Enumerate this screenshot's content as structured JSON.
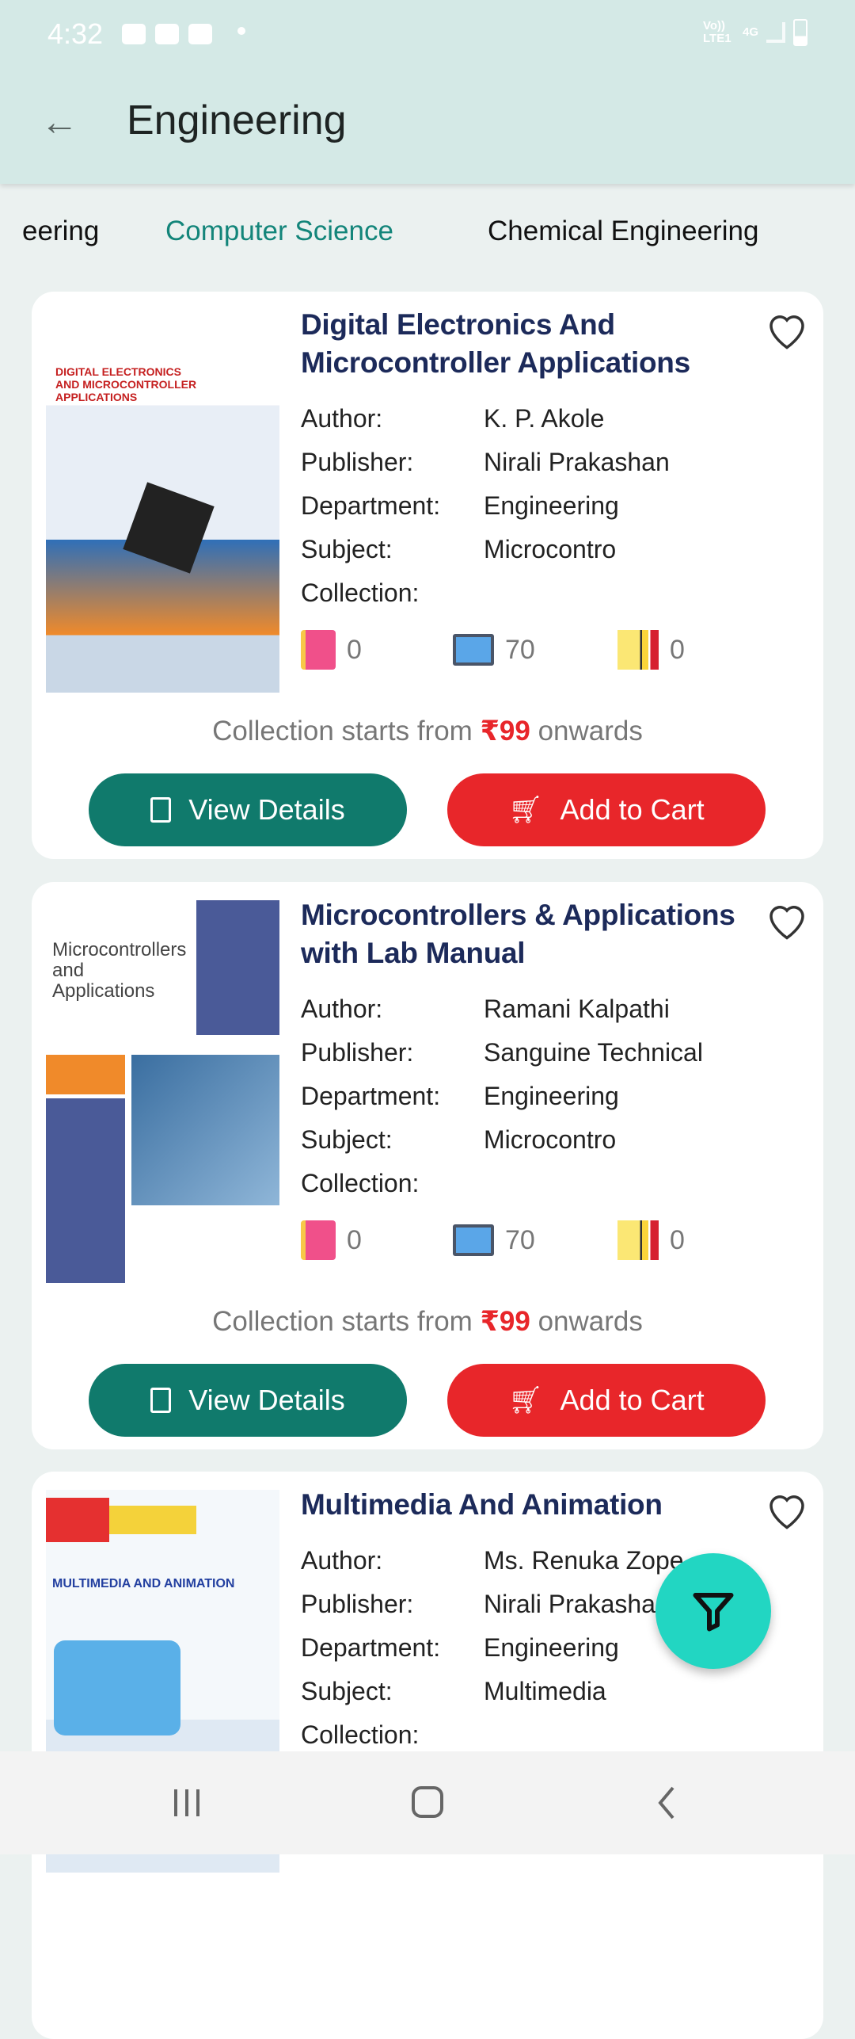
{
  "status_bar": {
    "time": "4:32",
    "network": "Vo)) LTE1",
    "net_type": "4G"
  },
  "header": {
    "title": "Engineering",
    "back_icon": "arrow-left-icon"
  },
  "tabs": [
    {
      "label": "eering",
      "active": false
    },
    {
      "label": "Computer Science",
      "active": true
    },
    {
      "label": "Chemical Engineering",
      "active": false
    }
  ],
  "labels": {
    "author": "Author:",
    "publisher": "Publisher:",
    "department": "Department:",
    "subject": "Subject:",
    "collection": "Collection:",
    "view_details": "View Details",
    "add_to_cart": "Add to Cart",
    "coll_prefix": "Collection starts from",
    "coll_suffix": "onwards"
  },
  "books": [
    {
      "title": "Digital Electronics And Microcontroller Applications",
      "author": "K. P. Akole",
      "publisher": "Nirali Prakashan",
      "department": "Engineering",
      "subject": "Microcontro",
      "collection": "",
      "ebook_count": "0",
      "video_count": "70",
      "notes_count": "0",
      "price": "₹99",
      "cover_text": "DIGITAL ELECTRONICS AND MICROCONTROLLER APPLICATIONS"
    },
    {
      "title": "Microcontrollers & Applications with Lab Manual",
      "author": "Ramani Kalpathi",
      "publisher": "Sanguine Technical",
      "department": "Engineering",
      "subject": "Microcontro",
      "collection": "",
      "ebook_count": "0",
      "video_count": "70",
      "notes_count": "0",
      "price": "₹99",
      "cover_text": "Microcontrollers and Applications"
    },
    {
      "title": "Multimedia And Animation",
      "author": "Ms. Renuka Zope",
      "publisher": "Nirali Prakashan",
      "department": "Engineering",
      "subject": "Multimedia",
      "collection": "",
      "cover_text": "MULTIMEDIA AND ANIMATION"
    }
  ],
  "colors": {
    "accent": "#107a6c",
    "cart": "#e8262a",
    "fab": "#22d6c2",
    "title": "#1c2a5a"
  }
}
